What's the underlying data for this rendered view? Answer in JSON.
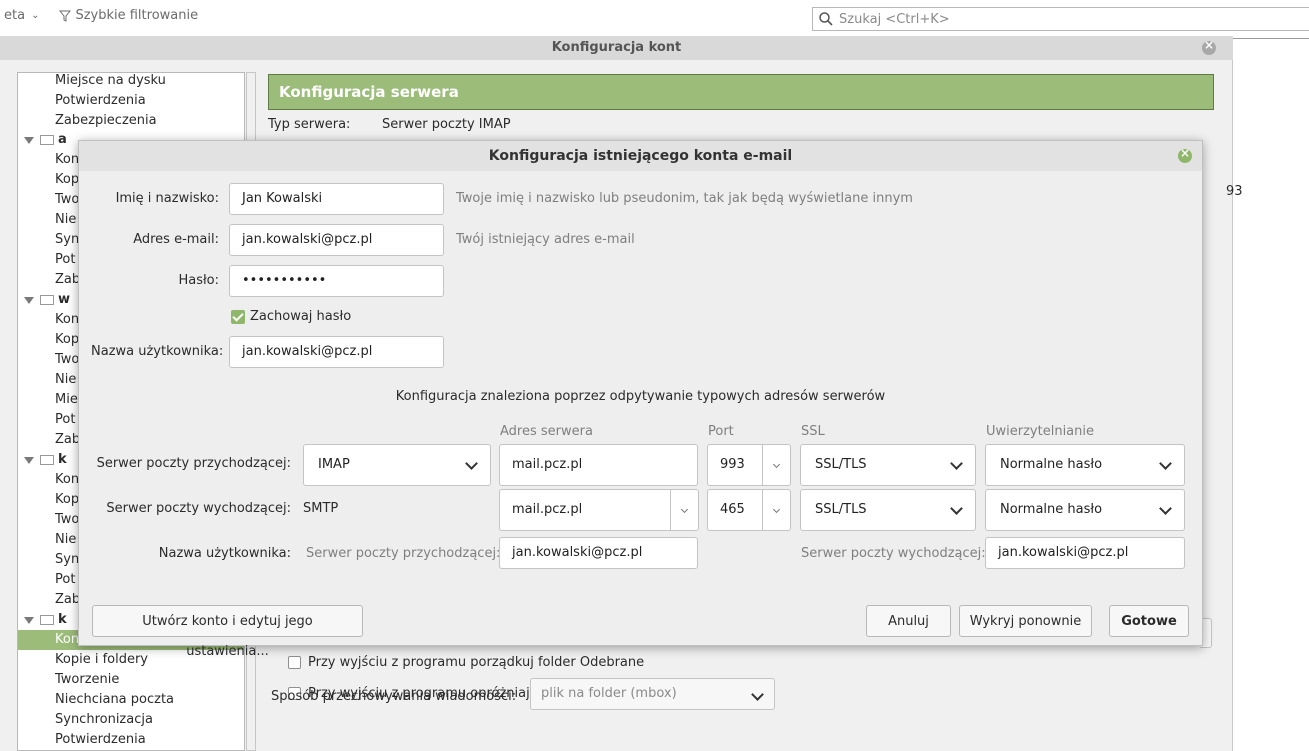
{
  "topbar": {
    "left_fragment": "eta",
    "quick_filter": "Szybkie filtrowanie",
    "search_placeholder": "Szukaj <Ctrl+K>"
  },
  "account_window": {
    "title": "Konfiguracja kont",
    "tree": {
      "items_top": [
        "Miejsce na dysku",
        "Potwierdzenia",
        "Zabezpieczenia"
      ],
      "account1_name": "a",
      "account1_items": [
        "Kon",
        "Kop",
        "Two",
        "Nie",
        "Syn",
        "Pot",
        "Zab"
      ],
      "account2_name": "w",
      "account2_items": [
        "Kon",
        "Kop",
        "Two",
        "Nie",
        "Mie",
        "Pot",
        "Zab"
      ],
      "account3_name": "k",
      "account3_items": [
        "Kon",
        "Kop",
        "Two",
        "Nie",
        "Syn",
        "Pot",
        "Zab"
      ],
      "account4_name": "k",
      "selected_item": "Konfiguracja serwera",
      "items_bottom": [
        "Kopie i foldery",
        "Tworzenie",
        "Niechciana poczta",
        "Synchronizacja",
        "Potwierdzenia"
      ]
    },
    "panel": {
      "header": "Konfiguracja serwera",
      "server_type_label": "Typ serwera:",
      "server_type_value": "Serwer poczty IMAP",
      "partial_value": "93",
      "check_cleanup": "Przy wyjściu z programu porządkuj folder Odebrane",
      "check_empty_trash": "Przy wyjściu z programu opróżniaj Kosz",
      "storage_label": "Sposób przechowywania wiadomości:",
      "storage_value": "plik na folder (mbox)"
    }
  },
  "dialog": {
    "title": "Konfiguracja istniejącego konta e-mail",
    "name_label": "Imię i nazwisko:",
    "name_value": "Jan Kowalski",
    "name_hint": "Twoje imię i nazwisko lub pseudonim, tak jak będą wyświetlane innym",
    "email_label": "Adres e-mail:",
    "email_value": "jan.kowalski@pcz.pl",
    "email_hint": "Twój istniejący adres e-mail",
    "password_label": "Hasło:",
    "password_value": "•••••••••••",
    "remember_label": "Zachowaj hasło",
    "username_label": "Nazwa użytkownika:",
    "username_value": "jan.kowalski@pcz.pl",
    "found_note": "Konfiguracja znaleziona poprzez odpytywanie typowych adresów serwerów",
    "columns": {
      "server_address": "Adres serwera",
      "port": "Port",
      "ssl": "SSL",
      "auth": "Uwierzytelnianie"
    },
    "incoming": {
      "label": "Serwer poczty przychodzącej:",
      "protocol": "IMAP",
      "host": "mail.pcz.pl",
      "port": "993",
      "ssl": "SSL/TLS",
      "auth": "Normalne hasło"
    },
    "outgoing": {
      "label": "Serwer poczty wychodzącej:",
      "protocol": "SMTP",
      "host": "mail.pcz.pl",
      "port": "465",
      "ssl": "SSL/TLS",
      "auth": "Normalne hasło"
    },
    "usernames": {
      "label": "Nazwa użytkownika:",
      "incoming_label": "Serwer poczty przychodzącej:",
      "incoming_value": "jan.kowalski@pcz.pl",
      "outgoing_label": "Serwer poczty wychodzącej:",
      "outgoing_value": "jan.kowalski@pcz.pl"
    },
    "buttons": {
      "create_edit": "Utwórz konto i edytuj jego ustawienia...",
      "cancel": "Anuluj",
      "retest": "Wykryj ponownie",
      "done": "Gotowe"
    }
  },
  "colors": {
    "accent_green": "#9cbc7a",
    "checkbox_green": "#8fb76a"
  }
}
